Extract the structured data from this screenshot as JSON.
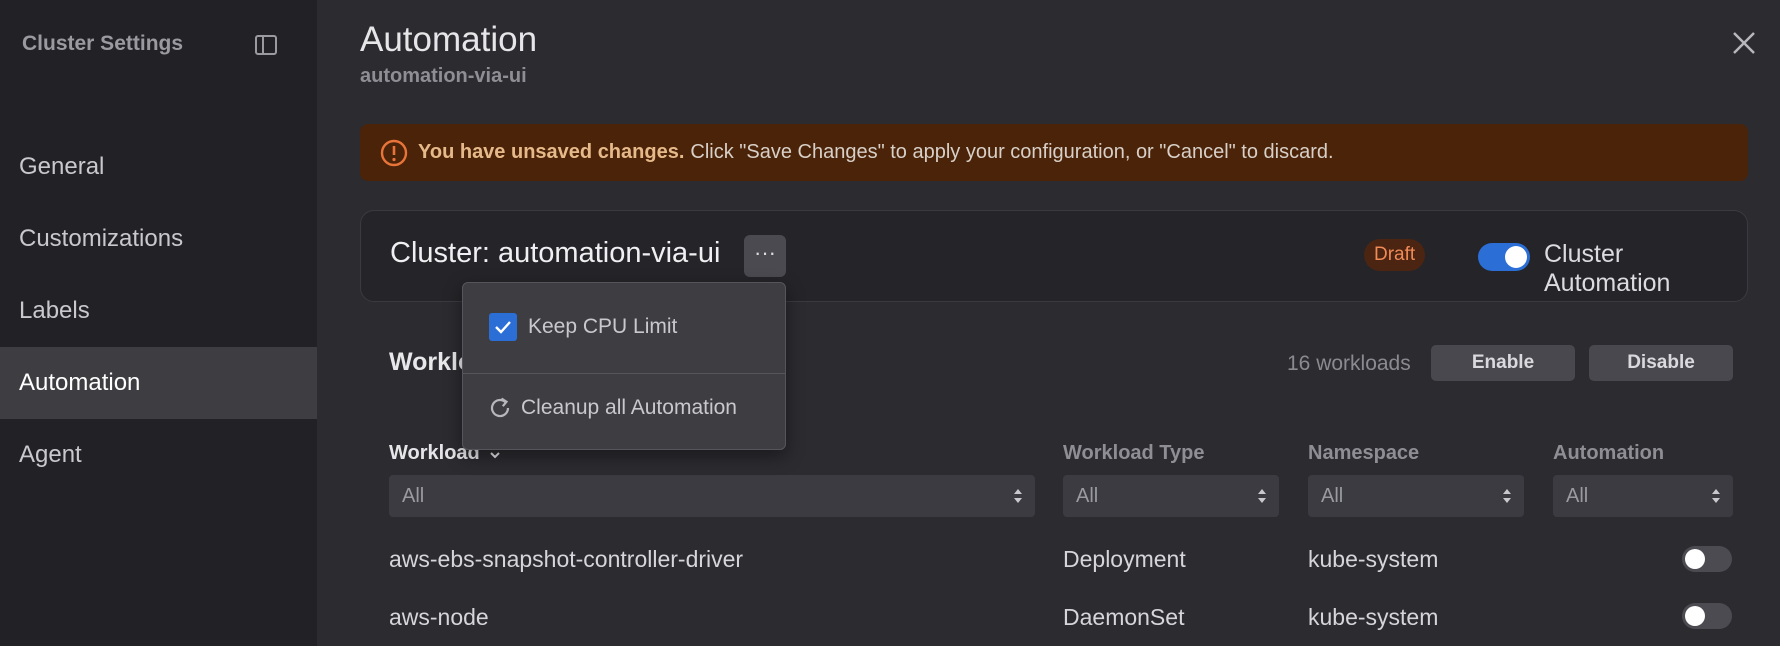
{
  "sidebar": {
    "header": "Cluster Settings",
    "items": [
      {
        "label": "General",
        "active": false
      },
      {
        "label": "Customizations",
        "active": false
      },
      {
        "label": "Labels",
        "active": false
      },
      {
        "label": "Automation",
        "active": true
      },
      {
        "label": "Agent",
        "active": false
      }
    ]
  },
  "header": {
    "title": "Automation",
    "subtitle": "automation-via-ui"
  },
  "banner": {
    "bold": "You have unsaved changes.",
    "text": "Click \"Save Changes\" to apply your configuration, or \"Cancel\" to discard."
  },
  "cluster": {
    "title": "Cluster: automation-via-ui",
    "more_label": "···",
    "badge": "Draft",
    "toggle_label": "Cluster Automation"
  },
  "menu": {
    "keep_cpu_label": "Keep CPU Limit",
    "cleanup_label": "Cleanup all Automation"
  },
  "workloads": {
    "title": "Worklo",
    "count": "16 workloads",
    "enable_label": "Enable",
    "disable_label": "Disable",
    "columns": {
      "workload": "Workload",
      "type": "Workload Type",
      "namespace": "Namespace",
      "automation": "Automation"
    },
    "filters": {
      "workload": "All",
      "type": "All",
      "namespace": "All",
      "automation": "All"
    },
    "rows": [
      {
        "name": "aws-ebs-snapshot-controller-driver",
        "type": "Deployment",
        "namespace": "kube-system",
        "automation": false
      },
      {
        "name": "aws-node",
        "type": "DaemonSet",
        "namespace": "kube-system",
        "automation": false
      }
    ]
  },
  "colors": {
    "accent": "#2a6ed6",
    "warning_bg": "#4a2308",
    "warning_icon": "#e8743a",
    "draft_text": "#f08a56"
  }
}
